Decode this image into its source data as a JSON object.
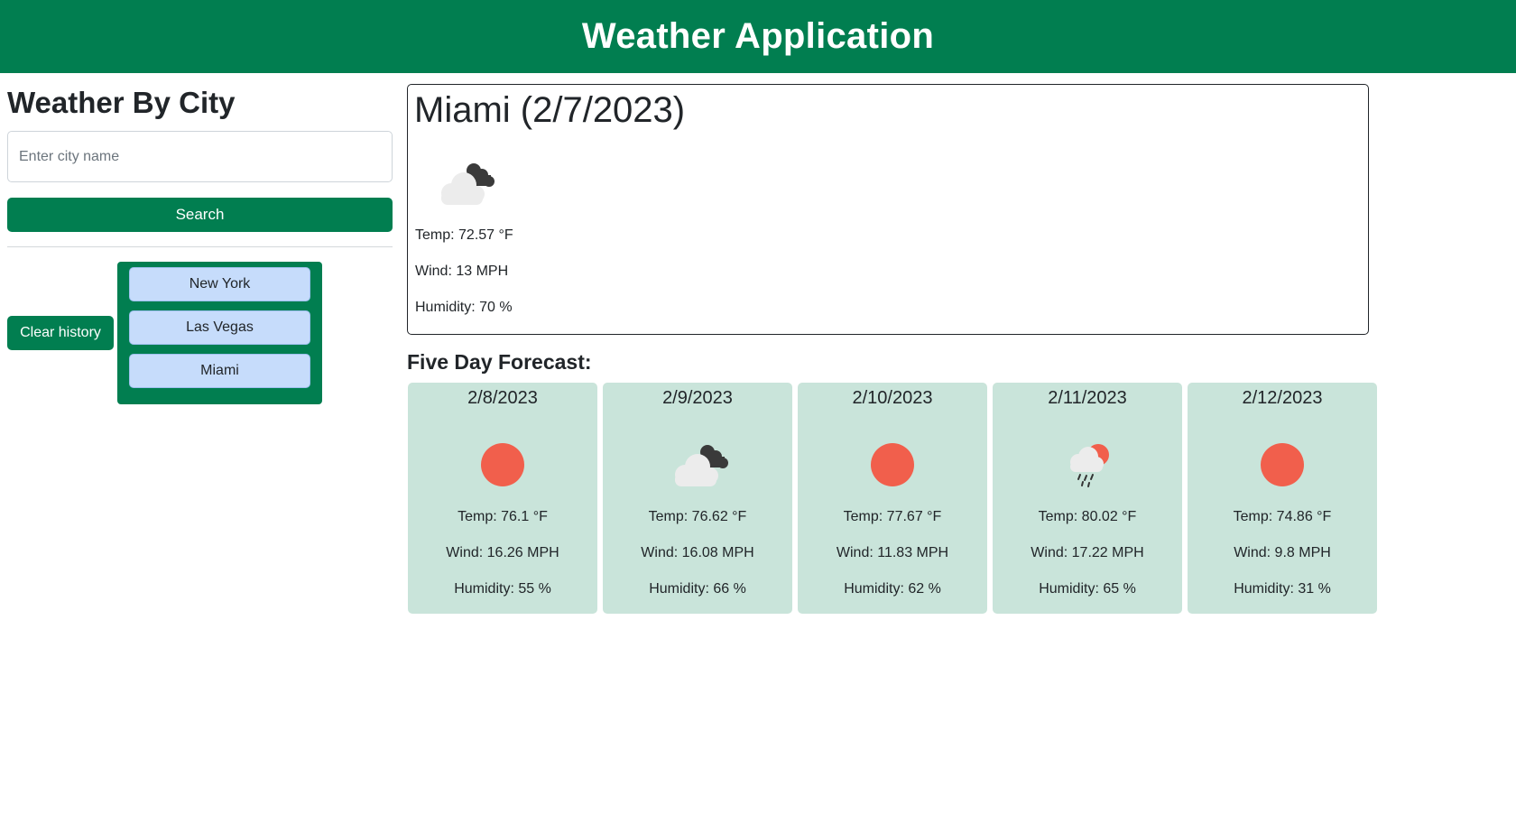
{
  "header": {
    "title": "Weather Application"
  },
  "sidebar": {
    "title": "Weather By City",
    "search_placeholder": "Enter city name",
    "search_label": "Search",
    "clear_label": "Clear history",
    "history": [
      "New York",
      "Las Vegas",
      "Miami"
    ]
  },
  "current": {
    "title": "Miami (2/7/2023)",
    "icon": "cloud-moon-icon",
    "temp": "Temp: 72.57 °F",
    "wind": "Wind: 13 MPH",
    "humidity": "Humidity: 70 %"
  },
  "forecast": {
    "title": "Five Day Forecast:",
    "days": [
      {
        "date": "2/8/2023",
        "icon": "sun-icon",
        "temp": "Temp: 76.1 °F",
        "wind": "Wind: 16.26 MPH",
        "humidity": "Humidity: 55 %"
      },
      {
        "date": "2/9/2023",
        "icon": "cloud-moon-icon",
        "temp": "Temp: 76.62 °F",
        "wind": "Wind: 16.08 MPH",
        "humidity": "Humidity: 66 %"
      },
      {
        "date": "2/10/2023",
        "icon": "sun-icon",
        "temp": "Temp: 77.67 °F",
        "wind": "Wind: 11.83 MPH",
        "humidity": "Humidity: 62 %"
      },
      {
        "date": "2/11/2023",
        "icon": "rain-sun-icon",
        "temp": "Temp: 80.02 °F",
        "wind": "Wind: 17.22 MPH",
        "humidity": "Humidity: 65 %"
      },
      {
        "date": "2/12/2023",
        "icon": "sun-icon",
        "temp": "Temp: 74.86 °F",
        "wind": "Wind: 9.8 MPH",
        "humidity": "Humidity: 31 %"
      }
    ]
  },
  "colors": {
    "brand": "#017e50",
    "forecast_card": "#c9e4da",
    "history_item": "#c6dcfb",
    "sun": "#f15f4c"
  }
}
